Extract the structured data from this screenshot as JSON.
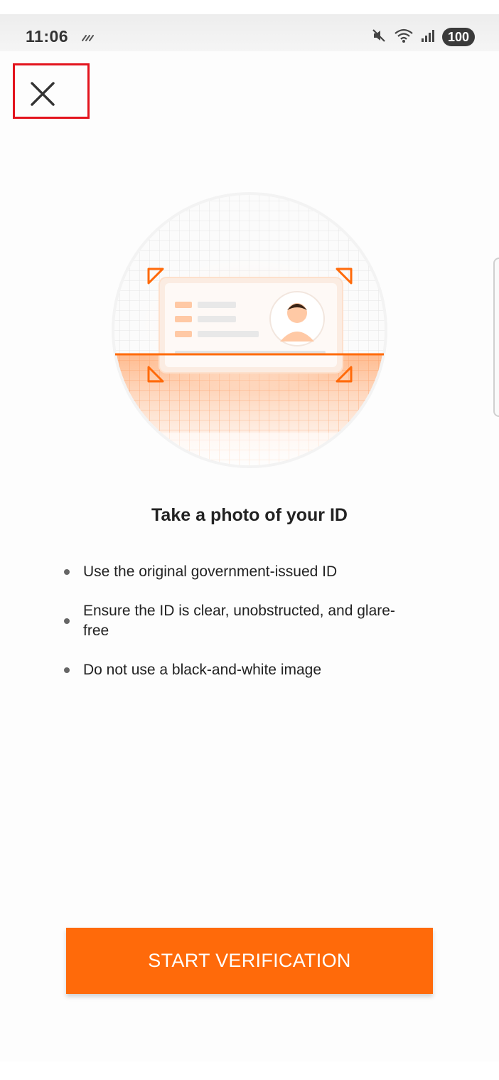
{
  "status_bar": {
    "time": "11:06",
    "battery": "100",
    "icons": [
      "sync-icon",
      "mute-icon",
      "wifi-icon",
      "signal-icon",
      "battery-icon"
    ]
  },
  "header": {
    "close_icon": "close-icon"
  },
  "illustration": {
    "icon": "id-card-scan-illustration",
    "accent_color": "#ff6a0a"
  },
  "main": {
    "title": "Take a photo of your ID",
    "bullets": [
      "Use the original government-issued ID",
      "Ensure the ID is clear, unobstructed, and glare-free",
      "Do not use a black-and-white image"
    ]
  },
  "footer": {
    "start_button_label": "START VERIFICATION",
    "button_color": "#ff6a0a"
  }
}
